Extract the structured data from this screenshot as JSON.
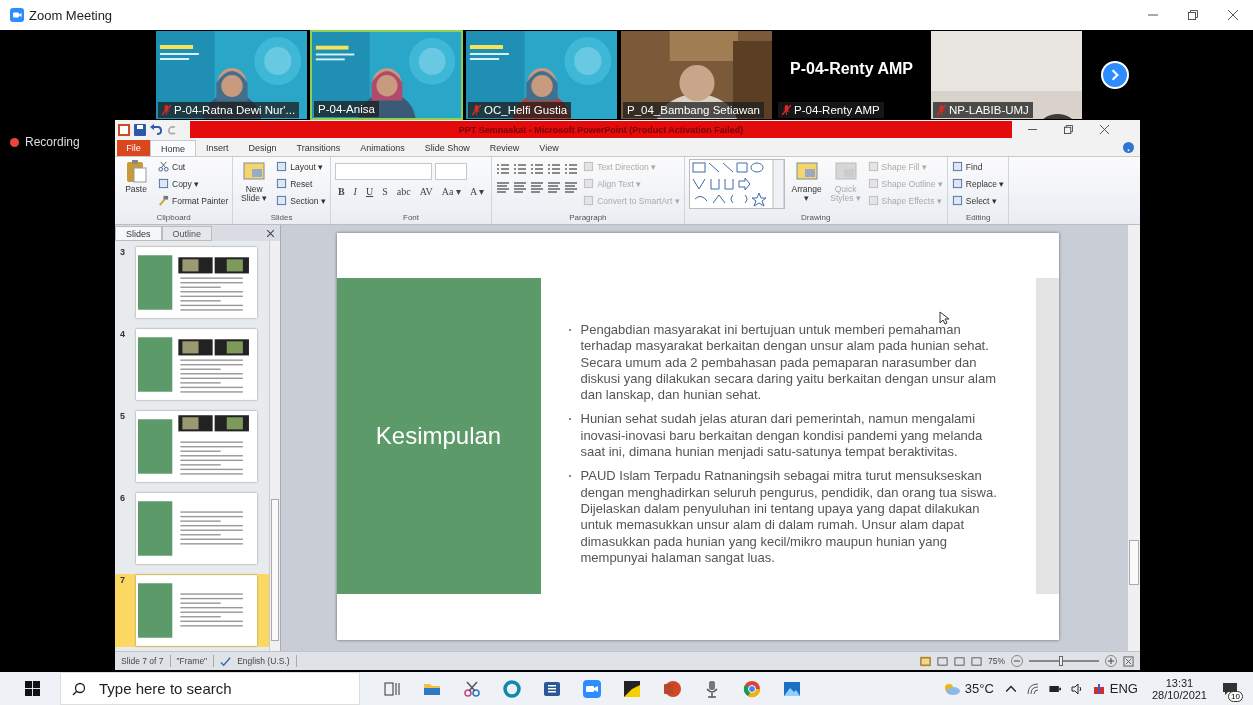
{
  "window": {
    "title": "Zoom Meeting"
  },
  "participants": [
    {
      "name": "P-04-Ratna Dewi Nur'...",
      "muted": true,
      "video": true,
      "speaking": false
    },
    {
      "name": "P-04-Anisa",
      "muted": false,
      "video": true,
      "speaking": true
    },
    {
      "name": "OC_Helfi Gustia",
      "muted": true,
      "video": true,
      "speaking": false
    },
    {
      "name": "P_04_Bambang Setiawan",
      "muted": false,
      "video": true,
      "speaking": false
    },
    {
      "name": "P-04-Renty AMP",
      "muted": true,
      "video": false,
      "speaking": false,
      "display_name": "P-04-Renty AMP"
    },
    {
      "name": "NP-LABIB-UMJ",
      "muted": true,
      "video": true,
      "speaking": false
    }
  ],
  "recording": {
    "label": "Recording"
  },
  "powerpoint": {
    "title": "PPT Semnaskat  -  Microsoft PowerPoint (Product Activation Failed)",
    "file_tab": "File",
    "tabs": [
      {
        "label": "Home",
        "selected": true
      },
      {
        "label": "Insert",
        "selected": false
      },
      {
        "label": "Design",
        "selected": false
      },
      {
        "label": "Transitions",
        "selected": false
      },
      {
        "label": "Animations",
        "selected": false
      },
      {
        "label": "Slide Show",
        "selected": false
      },
      {
        "label": "Review",
        "selected": false
      },
      {
        "label": "View",
        "selected": false
      }
    ],
    "groups": [
      {
        "name": "Clipboard",
        "large": [
          {
            "label": "Paste",
            "disabled": false
          }
        ],
        "small": [
          {
            "label": "Cut",
            "disabled": false
          },
          {
            "label": "Copy ▾",
            "disabled": false
          },
          {
            "label": "Format Painter",
            "disabled": false
          }
        ]
      },
      {
        "name": "Slides",
        "large": [
          {
            "label": "New Slide ▾",
            "disabled": false
          }
        ],
        "small": [
          {
            "label": "Layout ▾",
            "disabled": false
          },
          {
            "label": "Reset",
            "disabled": false
          },
          {
            "label": "Section ▾",
            "disabled": false
          }
        ]
      },
      {
        "name": "Font",
        "glyphs": [
          "B",
          "I",
          "U",
          "S",
          "abc",
          "AV",
          "Aa ▾",
          "A ▾"
        ]
      },
      {
        "name": "Paragraph",
        "small": [
          {
            "label": "Text Direction ▾",
            "disabled": true
          },
          {
            "label": "Align Text ▾",
            "disabled": true
          },
          {
            "label": "Convert to SmartArt ▾",
            "disabled": true
          }
        ]
      },
      {
        "name": "Drawing",
        "large": [
          {
            "label": "Arrange ▾",
            "disabled": false
          },
          {
            "label": "Quick Styles ▾",
            "disabled": true
          }
        ],
        "small": [
          {
            "label": "Shape Fill ▾",
            "disabled": true
          },
          {
            "label": "Shape Outline ▾",
            "disabled": true
          },
          {
            "label": "Shape Effects ▾",
            "disabled": true
          }
        ]
      },
      {
        "name": "Editing",
        "small": [
          {
            "label": "Find",
            "disabled": false
          },
          {
            "label": "Replace ▾",
            "disabled": false
          },
          {
            "label": "Select ▾",
            "disabled": false
          }
        ]
      }
    ]
  },
  "slides_panel": {
    "tabs": [
      {
        "label": "Slides",
        "selected": true
      },
      {
        "label": "Outline",
        "selected": false
      }
    ],
    "slides": [
      {
        "number": "3",
        "selected": false
      },
      {
        "number": "4",
        "selected": false
      },
      {
        "number": "5",
        "selected": false
      },
      {
        "number": "6",
        "selected": false
      },
      {
        "number": "7",
        "selected": true
      }
    ]
  },
  "slide": {
    "title": "Kesimpulan",
    "bullets": [
      "Pengabdian masyarakat ini bertujuan untuk memberi pemahaman terhadap masyarakat berkaitan dengan unsur alam pada hunian sehat. Secara umum ada 2 pembahasan pada pemaparan narasumber dan diskusi yang dilakukan secara daring yaitu berkaitan dengan unsur alam dan lanskap, dan hunian sehat.",
      "Hunian sehat sudah jelas aturan dari pemerintah, namun mengalami inovasi-inovasi baru berkaitan dengan kondisi pandemi yang melanda saat ini, dimana hunian menjadi satu-satunya tempat beraktivitas.",
      "PAUD Islam Terpadu Ratnaningsih sebagai mitra turut mensukseskan dengan menghadirkan seluruh pengurus, pendidik, dan orang tua siswa. Dijelaskan dalam penyuluhan ini tentang upaya yang dapat dilakukan untuk memasukkan unsur alam di dalam rumah. Unsur alam dapat dimasukkan pada hunian yang kecil/mikro maupun hunian yang mempunyai halaman sangat luas."
    ]
  },
  "status_bar": {
    "slide": "Slide 7 of 7",
    "theme": "\"Frame\"",
    "language": "English (U.S.)",
    "zoom": "75%",
    "zoom_slider": {
      "level": 0.45
    }
  },
  "taskbar": {
    "search_placeholder": "Type here to search",
    "temperature": "35°C",
    "language": "ENG",
    "time": "13:31",
    "date": "28/10/2021",
    "notifications": "10"
  }
}
